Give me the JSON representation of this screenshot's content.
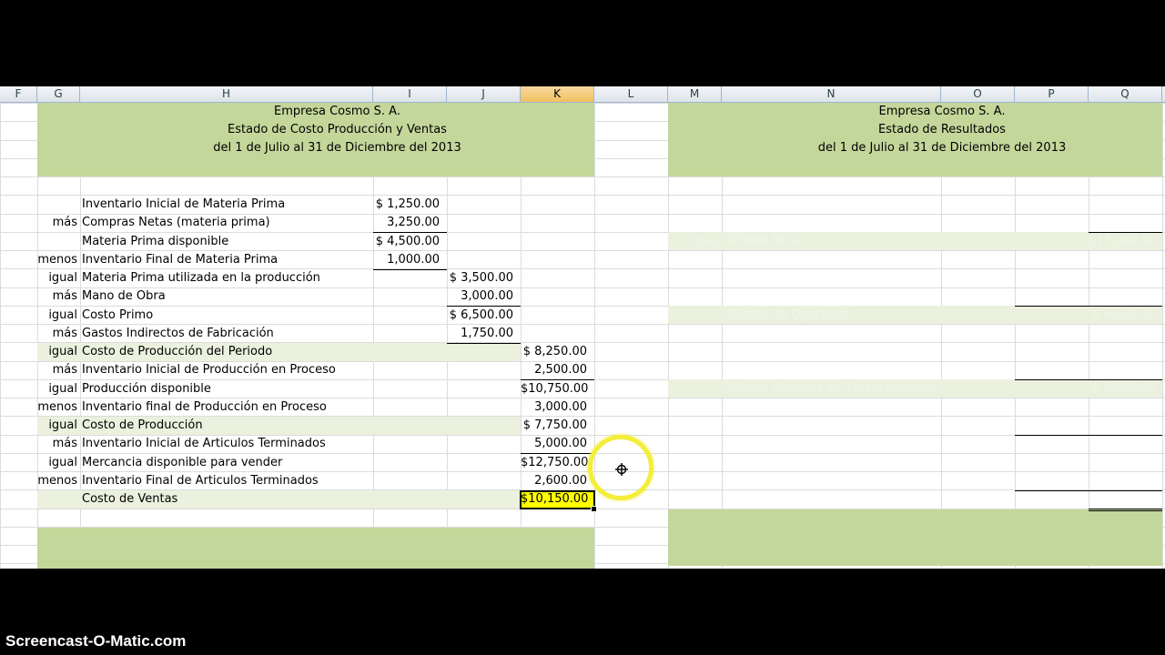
{
  "columns": [
    "F",
    "G",
    "H",
    "I",
    "J",
    "K",
    "L",
    "M",
    "N",
    "O",
    "P",
    "Q"
  ],
  "selected_column": "K",
  "left_header": {
    "line1": "Empresa Cosmo S. A.",
    "line2": "Estado de Costo Producción y Ventas",
    "line3": "del 1 de Julio al 31 de Diciembre del 2013"
  },
  "right_header": {
    "line1": "Empresa Cosmo S. A.",
    "line2": "Estado de Resultados",
    "line3": "del 1 de Julio al 31 de Diciembre del 2013"
  },
  "cost_rows": [
    {
      "op": "",
      "label": "Inventario Inicial de Materia Prima",
      "i": "$ 1,250.00",
      "j": "",
      "k": ""
    },
    {
      "op": "más",
      "label": "Compras Netas (materia prima)",
      "i": "3,250.00",
      "j": "",
      "k": ""
    },
    {
      "op": "",
      "label": "Materia Prima disponible",
      "i": "$ 4,500.00",
      "j": "",
      "k": ""
    },
    {
      "op": "menos",
      "label": "Inventario Final de Materia Prima",
      "i": "1,000.00",
      "j": "",
      "k": ""
    },
    {
      "op": "igual",
      "label": "Materia Prima utilizada en la producción",
      "i": "",
      "j": "$ 3,500.00",
      "k": ""
    },
    {
      "op": "más",
      "label": "Mano de Obra",
      "i": "",
      "j": "3,000.00",
      "k": ""
    },
    {
      "op": "igual",
      "label": "Costo Primo",
      "i": "",
      "j": "$ 6,500.00",
      "k": ""
    },
    {
      "op": "más",
      "label": "Gastos Indirectos de Fabricación",
      "i": "",
      "j": "1,750.00",
      "k": ""
    },
    {
      "op": "igual",
      "label": "Costo de Producción del Periodo",
      "i": "",
      "j": "",
      "k": "$ 8,250.00"
    },
    {
      "op": "más",
      "label": "Inventario Inicial de Producción en Proceso",
      "i": "",
      "j": "",
      "k": "2,500.00"
    },
    {
      "op": "igual",
      "label": "Producción disponible",
      "i": "",
      "j": "",
      "k": "$10,750.00"
    },
    {
      "op": "menos",
      "label": "Inventario final de Producción en Proceso",
      "i": "",
      "j": "",
      "k": "3,000.00"
    },
    {
      "op": "igual",
      "label": "Costo de Producción",
      "i": "",
      "j": "",
      "k": "$ 7,750.00"
    },
    {
      "op": "más",
      "label": "Inventario Inicial de  Articulos Terminados",
      "i": "",
      "j": "",
      "k": "5,000.00"
    },
    {
      "op": "igual",
      "label": "Mercancia disponible para vender",
      "i": "",
      "j": "",
      "k": "$12,750.00"
    },
    {
      "op": "menos",
      "label": "Inventario Final de Articulos Terminados",
      "i": "",
      "j": "",
      "k": "2,600.00"
    },
    {
      "op": "",
      "label": "Costo de Ventas",
      "i": "",
      "j": "",
      "k": "$10,150.00"
    }
  ],
  "income_rows": [
    {
      "op": "igual",
      "label": "Utilidad Bruta",
      "q": "$17,000.00"
    },
    {
      "op": "",
      "label": "Utilidad de Operación",
      "q": "$  6,500.00"
    },
    {
      "op": "",
      "label": "Utilidad despues del Financiamiento",
      "q": "$  5,000.00"
    }
  ],
  "watermark": "Screencast-O-Matic.com"
}
